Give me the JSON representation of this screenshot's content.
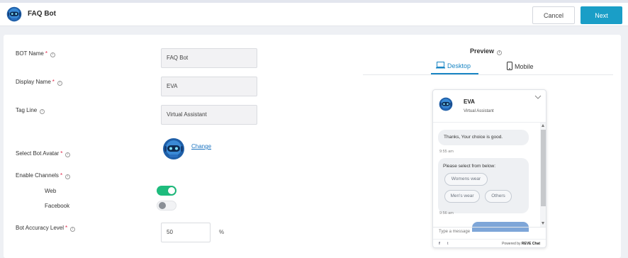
{
  "header": {
    "title": "FAQ Bot",
    "cancel_label": "Cancel",
    "next_label": "Next"
  },
  "form": {
    "bot_name": {
      "label": "BOT Name",
      "value": "FAQ Bot"
    },
    "display_name": {
      "label": "Display Name",
      "value": "EVA"
    },
    "tag_line": {
      "label": "Tag Line",
      "value": "Virtual Assistant"
    },
    "bot_avatar": {
      "label": "Select Bot Avatar",
      "change_label": "Change"
    },
    "channels": {
      "label": "Enable Channels",
      "web": {
        "label": "Web",
        "enabled": true
      },
      "facebook": {
        "label": "Facebook",
        "enabled": false
      }
    },
    "accuracy": {
      "label": "Bot Accuracy Level",
      "value": "50",
      "unit": "%"
    }
  },
  "preview": {
    "title": "Preview",
    "tabs": [
      {
        "label": "Desktop",
        "active": true
      },
      {
        "label": "Mobile",
        "active": false
      }
    ],
    "widget": {
      "name": "EVA",
      "tagline": "Virtual Assistant",
      "messages": [
        {
          "text": "Thanks, Your choice is good.",
          "time": "9:55 am"
        },
        {
          "text": "Please select from below:",
          "options": [
            "Womens wear",
            "Men's wear",
            "Others"
          ],
          "time": "9:56 am"
        }
      ],
      "input_placeholder": "Type a message",
      "social": [
        "f",
        "t"
      ],
      "powered_by": "Powered by",
      "brand": "REVE Chat"
    }
  },
  "colors": {
    "accent": "#1a9ec7",
    "toggle_on": "#1ebc7d",
    "required": "#e0284a",
    "link": "#1a73c0"
  }
}
